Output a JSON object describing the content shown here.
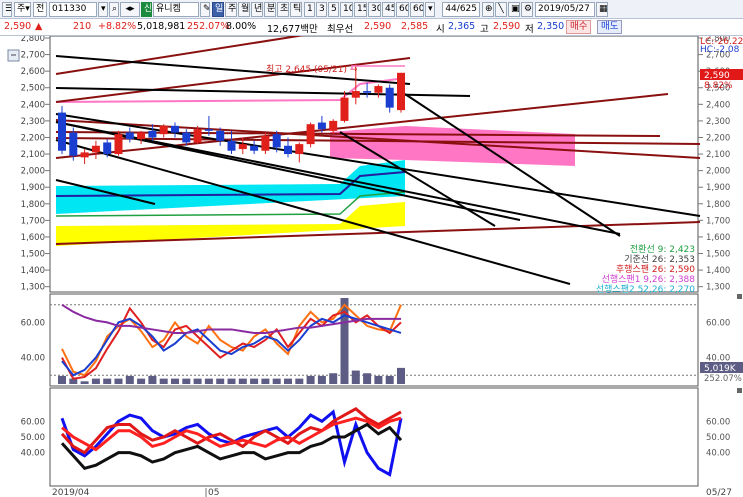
{
  "toolbar": {
    "market_label": "주",
    "market_suffix": "전",
    "code": "011330",
    "stock_badge": "신",
    "stock_name": "유니켐",
    "period_buttons": [
      "일",
      "주",
      "월",
      "년",
      "분",
      "초",
      "틱"
    ],
    "selected_period": "일",
    "interval_buttons": [
      "1",
      "3",
      "5",
      "10",
      "15",
      "30",
      "45",
      "60",
      "60"
    ],
    "count_display": "44/625",
    "date": "2019/05/27"
  },
  "quote": {
    "price": "2,590",
    "change": "210",
    "change_pct": "+8.82%",
    "volume": "5,018,981",
    "vol_ratio": "252.07%",
    "turnover_rate": "8.00%",
    "amount": "12,677백만",
    "priority_label": "최우선",
    "ask": "2,590",
    "bid": "2,585",
    "open_label": "시",
    "open": "2,365",
    "high_label": "고",
    "high": "2,590",
    "low_label": "저",
    "low": "2,350",
    "buy_button": "매수",
    "sell_button": "매도"
  },
  "colors": {
    "up": "#e0201a",
    "down": "#1a3fd0",
    "cyan_band": "#00e0f0",
    "yellow_band": "#ffff00",
    "pink_band": "#ff6fc0",
    "volume_bar": "#5c5c84"
  },
  "chart_data": [
    {
      "type": "candlestick",
      "ylim": [
        1280,
        2800
      ],
      "yticks": [
        1300,
        1400,
        1500,
        1600,
        1700,
        1800,
        1900,
        2000,
        2100,
        2200,
        2300,
        2400,
        2500,
        2600,
        2700,
        2800
      ],
      "ytick_labels": [
        "1,300",
        "1,400",
        "1,500",
        "1,600",
        "1,700",
        "1,800",
        "1,900",
        "2,000",
        "2,100",
        "2,200",
        "2,300",
        "2,400",
        "2,500",
        "2,600",
        "2,700",
        "2,800"
      ],
      "candles": [
        {
          "o": 2350,
          "h": 2390,
          "l": 2100,
          "c": 2120
        },
        {
          "o": 2230,
          "h": 2260,
          "l": 2060,
          "c": 2090
        },
        {
          "o": 2080,
          "h": 2130,
          "l": 2040,
          "c": 2110
        },
        {
          "o": 2110,
          "h": 2180,
          "l": 2070,
          "c": 2150
        },
        {
          "o": 2170,
          "h": 2190,
          "l": 2080,
          "c": 2100
        },
        {
          "o": 2100,
          "h": 2240,
          "l": 2090,
          "c": 2220
        },
        {
          "o": 2230,
          "h": 2260,
          "l": 2170,
          "c": 2190
        },
        {
          "o": 2190,
          "h": 2240,
          "l": 2160,
          "c": 2230
        },
        {
          "o": 2240,
          "h": 2280,
          "l": 2180,
          "c": 2200
        },
        {
          "o": 2220,
          "h": 2280,
          "l": 2200,
          "c": 2270
        },
        {
          "o": 2270,
          "h": 2290,
          "l": 2200,
          "c": 2230
        },
        {
          "o": 2230,
          "h": 2250,
          "l": 2150,
          "c": 2170
        },
        {
          "o": 2170,
          "h": 2270,
          "l": 2160,
          "c": 2250
        },
        {
          "o": 2250,
          "h": 2330,
          "l": 2210,
          "c": 2240
        },
        {
          "o": 2240,
          "h": 2260,
          "l": 2150,
          "c": 2180
        },
        {
          "o": 2180,
          "h": 2240,
          "l": 2100,
          "c": 2120
        },
        {
          "o": 2130,
          "h": 2200,
          "l": 2100,
          "c": 2160
        },
        {
          "o": 2150,
          "h": 2180,
          "l": 2100,
          "c": 2120
        },
        {
          "o": 2120,
          "h": 2230,
          "l": 2100,
          "c": 2210
        },
        {
          "o": 2220,
          "h": 2240,
          "l": 2110,
          "c": 2140
        },
        {
          "o": 2150,
          "h": 2200,
          "l": 2080,
          "c": 2100
        },
        {
          "o": 2100,
          "h": 2170,
          "l": 2050,
          "c": 2160
        },
        {
          "o": 2160,
          "h": 2290,
          "l": 2140,
          "c": 2280
        },
        {
          "o": 2290,
          "h": 2330,
          "l": 2230,
          "c": 2250
        },
        {
          "o": 2240,
          "h": 2310,
          "l": 2220,
          "c": 2300
        },
        {
          "o": 2300,
          "h": 2480,
          "l": 2290,
          "c": 2440
        },
        {
          "o": 2440,
          "h": 2645,
          "l": 2400,
          "c": 2480
        },
        {
          "o": 2480,
          "h": 2530,
          "l": 2440,
          "c": 2470
        },
        {
          "o": 2470,
          "h": 2520,
          "l": 2440,
          "c": 2510
        },
        {
          "o": 2500,
          "h": 2520,
          "l": 2350,
          "c": 2380
        },
        {
          "o": 2365,
          "h": 2590,
          "l": 2350,
          "c": 2590
        }
      ],
      "annotation": "최고 2,645 (05/21) →",
      "price_labels": [
        {
          "text": "LC:-26.22",
          "color": "#d02020"
        },
        {
          "text": "HC:-2.08",
          "color": "#2040d0"
        }
      ],
      "current_price_badge": "2,590",
      "current_change": "8.82%",
      "legend": [
        {
          "text": "전환선 9: 2,423",
          "color": "#20a040"
        },
        {
          "text": "기준선 26: 2,353",
          "color": "#404040"
        },
        {
          "text": "후행스팬 26: 2,590",
          "color": "#d02020"
        },
        {
          "text": "선행스팬1 9,26: 2,388",
          "color": "#d040d0"
        },
        {
          "text": "선행스팬2 52,26: 2,270",
          "color": "#20b0d0"
        }
      ]
    },
    {
      "type": "line",
      "ylim": [
        25,
        75
      ],
      "ytick_labels": [
        "60.00",
        "40.00"
      ],
      "yticks": [
        60,
        40
      ],
      "series": [
        {
          "color": "#ff7010",
          "values": [
            45,
            32,
            30,
            38,
            52,
            58,
            62,
            55,
            46,
            50,
            60,
            52,
            48,
            58,
            50,
            46,
            44,
            52,
            56,
            48,
            42,
            58,
            66,
            60,
            62,
            70,
            64,
            58,
            56,
            55,
            70
          ]
        },
        {
          "color": "#e02020",
          "values": [
            40,
            28,
            29,
            34,
            45,
            55,
            68,
            60,
            50,
            46,
            56,
            58,
            52,
            46,
            40,
            44,
            48,
            46,
            50,
            56,
            46,
            54,
            62,
            58,
            64,
            66,
            60,
            64,
            58,
            54,
            60
          ]
        },
        {
          "color": "#1a3fd0",
          "values": [
            38,
            30,
            33,
            40,
            50,
            60,
            62,
            58,
            52,
            44,
            48,
            54,
            56,
            50,
            44,
            42,
            46,
            48,
            52,
            50,
            44,
            50,
            58,
            62,
            60,
            64,
            62,
            60,
            58,
            56,
            54
          ]
        },
        {
          "color": "#8a2aa0",
          "values": [
            70,
            66,
            63,
            61,
            60,
            58,
            58,
            57,
            56,
            55,
            54,
            54,
            55,
            56,
            56,
            56,
            55,
            54,
            54,
            55,
            56,
            57,
            57,
            58,
            59,
            60,
            61,
            62,
            62,
            62,
            62
          ]
        }
      ],
      "volume": [
        3,
        2,
        1,
        2,
        2,
        2,
        3,
        2,
        3,
        2,
        2,
        2,
        2,
        2,
        2,
        2,
        2,
        2,
        2,
        2,
        2,
        2,
        3,
        3,
        4,
        32,
        5,
        4,
        3,
        3,
        6
      ],
      "volume_label": "5,019K",
      "volume_pct": "252.07%"
    },
    {
      "type": "line",
      "ylim": [
        20,
        80
      ],
      "ytick_labels": [
        "60.00",
        "50.00",
        "40.00"
      ],
      "yticks": [
        60,
        50,
        40
      ],
      "series": [
        {
          "color": "#1010f0",
          "values": [
            62,
            42,
            38,
            44,
            52,
            60,
            64,
            62,
            54,
            50,
            52,
            56,
            58,
            52,
            48,
            46,
            50,
            52,
            54,
            56,
            50,
            56,
            64,
            60,
            66,
            34,
            58,
            40,
            30,
            26,
            62
          ]
        },
        {
          "color": "#e01818",
          "values": [
            52,
            44,
            40,
            48,
            56,
            58,
            58,
            52,
            48,
            50,
            54,
            50,
            46,
            50,
            52,
            48,
            44,
            50,
            54,
            50,
            46,
            52,
            56,
            54,
            60,
            64,
            68,
            62,
            58,
            62,
            66
          ]
        },
        {
          "color": "#ff2020",
          "values": [
            56,
            50,
            46,
            42,
            48,
            54,
            54,
            50,
            44,
            46,
            50,
            54,
            52,
            48,
            44,
            46,
            48,
            46,
            44,
            48,
            50,
            46,
            50,
            54,
            58,
            60,
            62,
            60,
            56,
            60,
            62
          ]
        },
        {
          "color": "#101010",
          "values": [
            46,
            38,
            30,
            32,
            36,
            40,
            40,
            38,
            34,
            36,
            40,
            42,
            44,
            40,
            36,
            38,
            40,
            40,
            36,
            38,
            40,
            40,
            44,
            46,
            50,
            50,
            54,
            58,
            52,
            56,
            48
          ]
        }
      ],
      "x_labels": [
        "2019/04",
        "05",
        "05/27"
      ]
    }
  ]
}
